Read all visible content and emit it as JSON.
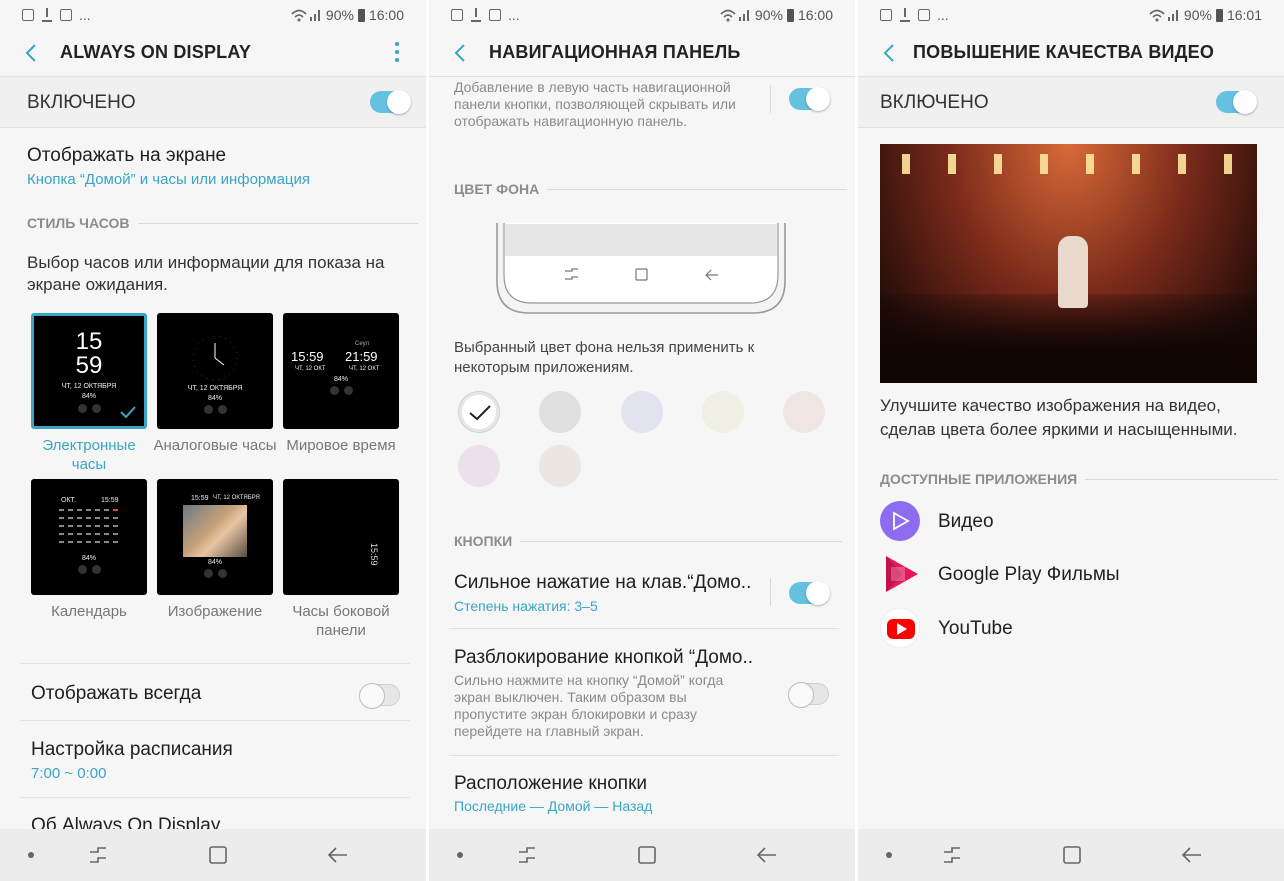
{
  "screen1": {
    "status": {
      "left": "...",
      "battery": "90%",
      "time": "16:00"
    },
    "header": {
      "title": "ALWAYS ON DISPLAY"
    },
    "enabled": {
      "label": "ВКЛЮЧЕНО",
      "on": true
    },
    "display_on_screen": {
      "title": "Отображать на экране",
      "value": "Кнопка “Домой” и часы или информация"
    },
    "clock_style": {
      "heading": "СТИЛЬ ЧАСОВ",
      "description": "Выбор часов или информации для показа на экране ожидания.",
      "styles": [
        {
          "label": "Электронные часы",
          "selected": true,
          "time_h": "15",
          "time_m": "59",
          "date": "ЧТ, 12 ОКТЯБРЯ",
          "battery": "84%"
        },
        {
          "label": "Аналоговые часы",
          "selected": false,
          "date": "ЧТ, 12 ОКТЯБРЯ",
          "battery": "84%"
        },
        {
          "label": "Мировое время",
          "selected": false,
          "city": "Сеул",
          "time1": "15:59",
          "time2": "21:59",
          "date1": "ЧТ, 12 ОКТ",
          "date2": "ЧТ, 12 ОКТ",
          "battery": "84%"
        },
        {
          "label": "Календарь",
          "selected": false,
          "month": "ОКТ.",
          "time": "15:59",
          "battery": "84%"
        },
        {
          "label": "Изображение",
          "selected": false,
          "time": "15:59",
          "date": "ЧТ, 12 ОКТЯБРЯ",
          "battery": "84%"
        },
        {
          "label": "Часы боковой панели",
          "selected": false,
          "time": "15:59"
        }
      ]
    },
    "always_show": {
      "label": "Отображать всегда",
      "on": false
    },
    "schedule": {
      "title": "Настройка расписания",
      "value": "7:00 ~ 0:00"
    },
    "about": {
      "title": "Об Always On Display"
    }
  },
  "screen2": {
    "status": {
      "left": "...",
      "battery": "90%",
      "time": "16:00"
    },
    "header": {
      "title": "НАВИГАЦИОННАЯ ПАНЕЛЬ"
    },
    "intro": {
      "text": "Добавление в левую часть навигационной панели кнопки, позволяющей скрывать или отображать навигационную панель.",
      "on": true
    },
    "bg_color": {
      "heading": "ЦВЕТ ФОНА",
      "note": "Выбранный цвет фона нельзя применить к некоторым приложениям.",
      "swatches": [
        "#ffffff",
        "#e0e0e0",
        "#e3e3f0",
        "#efefe4",
        "#efe6e4",
        "#ede0ec",
        "#ebe6e2"
      ],
      "selected_index": 0
    },
    "buttons": {
      "heading": "КНОПКИ",
      "press": {
        "title": "Сильное нажатие на клав.“Домо..",
        "value": "Степень нажатия: 3–5",
        "on": true
      },
      "unlock": {
        "title": "Разблокирование кнопкой “Домо..",
        "desc": "Сильно нажмите на кнопку “Домой” когда экран выключен. Таким образом вы пропустите экран блокировки и сразу перейдете на главный экран.",
        "on": false
      },
      "layout": {
        "title": "Расположение кнопки",
        "value": "Последние — Домой — Назад"
      }
    }
  },
  "screen3": {
    "status": {
      "left": "...",
      "battery": "90%",
      "time": "16:01"
    },
    "header": {
      "title": "ПОВЫШЕНИЕ КАЧЕСТВА ВИДЕО"
    },
    "enabled": {
      "label": "ВКЛЮЧЕНО",
      "on": true
    },
    "description": "Улучшите качество изображения на видео, сделав цвета более яркими и насыщенными.",
    "apps": {
      "heading": "ДОСТУПНЫЕ ПРИЛОЖЕНИЯ",
      "items": [
        {
          "name": "Видео",
          "icon": "video-play-icon",
          "color": "#8e6cf0"
        },
        {
          "name": "Google Play Фильмы",
          "icon": "google-play-movies-icon",
          "color": "#e5175d"
        },
        {
          "name": "YouTube",
          "icon": "youtube-icon",
          "color": "#ff0000"
        }
      ]
    }
  },
  "colors": {
    "accent": "#3aa5c4",
    "toggle_on": "#64c2e0"
  }
}
